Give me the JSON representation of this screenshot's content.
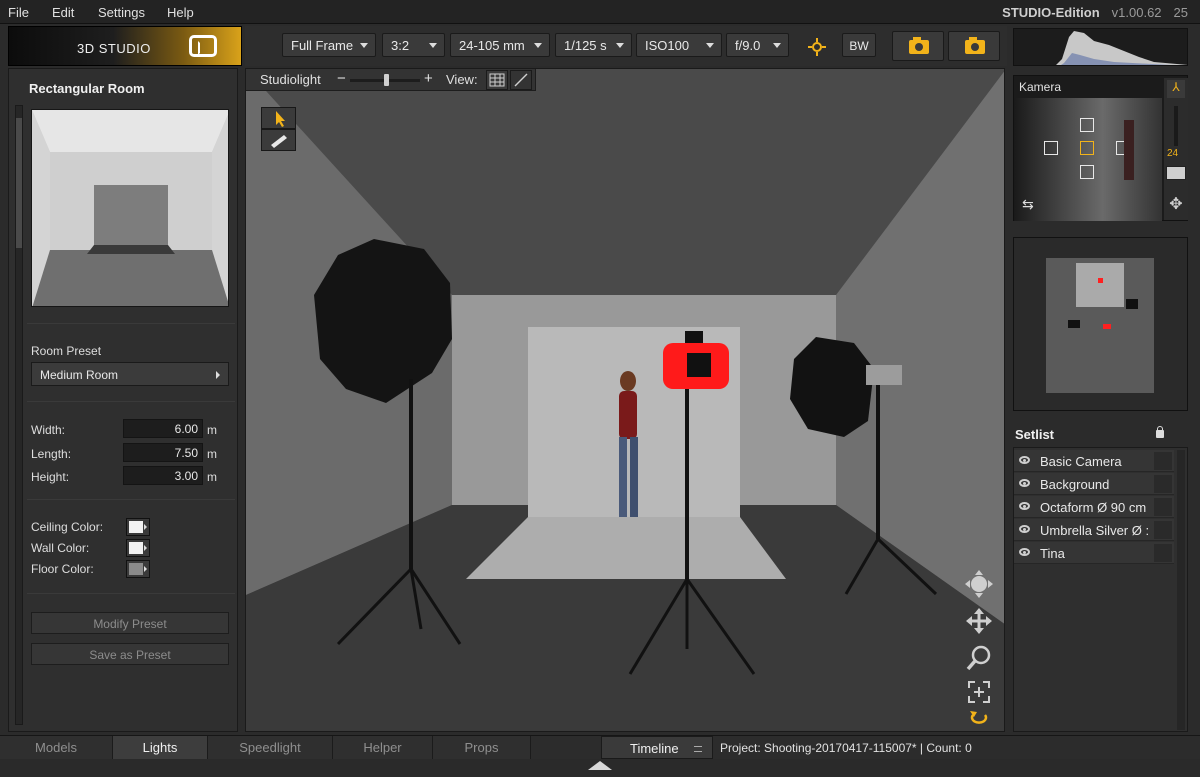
{
  "menu": {
    "items": [
      "File",
      "Edit",
      "Settings",
      "Help"
    ]
  },
  "edition": {
    "name": "STUDIO-Edition",
    "version": "v1.00.62",
    "extra": "25"
  },
  "logo": {
    "text": "3D STUDIO"
  },
  "toolbar": {
    "sensor": "Full Frame",
    "aspect": "3:2",
    "lens": "24-105 mm",
    "shutter": "1/125 s",
    "iso": "ISO100",
    "aperture": "f/9.0",
    "bw_label": "BW"
  },
  "left_panel": {
    "title": "Rectangular Room",
    "preset_label": "Room Preset",
    "preset_value": "Medium Room",
    "width_label": "Width:",
    "width_value": "6.00",
    "length_label": "Length:",
    "length_value": "7.50",
    "height_label": "Height:",
    "height_value": "3.00",
    "unit": "m",
    "ceiling_label": "Ceiling Color:",
    "wall_label": "Wall Color:",
    "floor_label": "Floor Color:",
    "ceiling_color": "#f2f2f2",
    "wall_color": "#f2f2f2",
    "floor_color": "#8a8a8a",
    "modify_label": "Modify Preset",
    "save_label": "Save as Preset"
  },
  "viewport": {
    "light_label": "Studiolight",
    "minus": "−",
    "plus": "+",
    "view_label": "View:",
    "camera_color": "#ff1a1a"
  },
  "camera_panel": {
    "label": "Kamera",
    "zoom_value": "24"
  },
  "setlist": {
    "title": "Setlist",
    "items": [
      "Basic Camera",
      "Background",
      "Octaform Ø 90 cm",
      "Umbrella Silver Ø :",
      "Tina"
    ]
  },
  "bottom": {
    "tabs": [
      "Models",
      "Lights",
      "Speedlight",
      "Helper",
      "Props"
    ],
    "active_tab": "Lights",
    "timeline_label": "Timeline",
    "project_text": "Project: Shooting-20170417-115007*   |  Count: 0"
  },
  "colors": {
    "accent": "#f2b31a",
    "background": "#2b2b2b"
  }
}
